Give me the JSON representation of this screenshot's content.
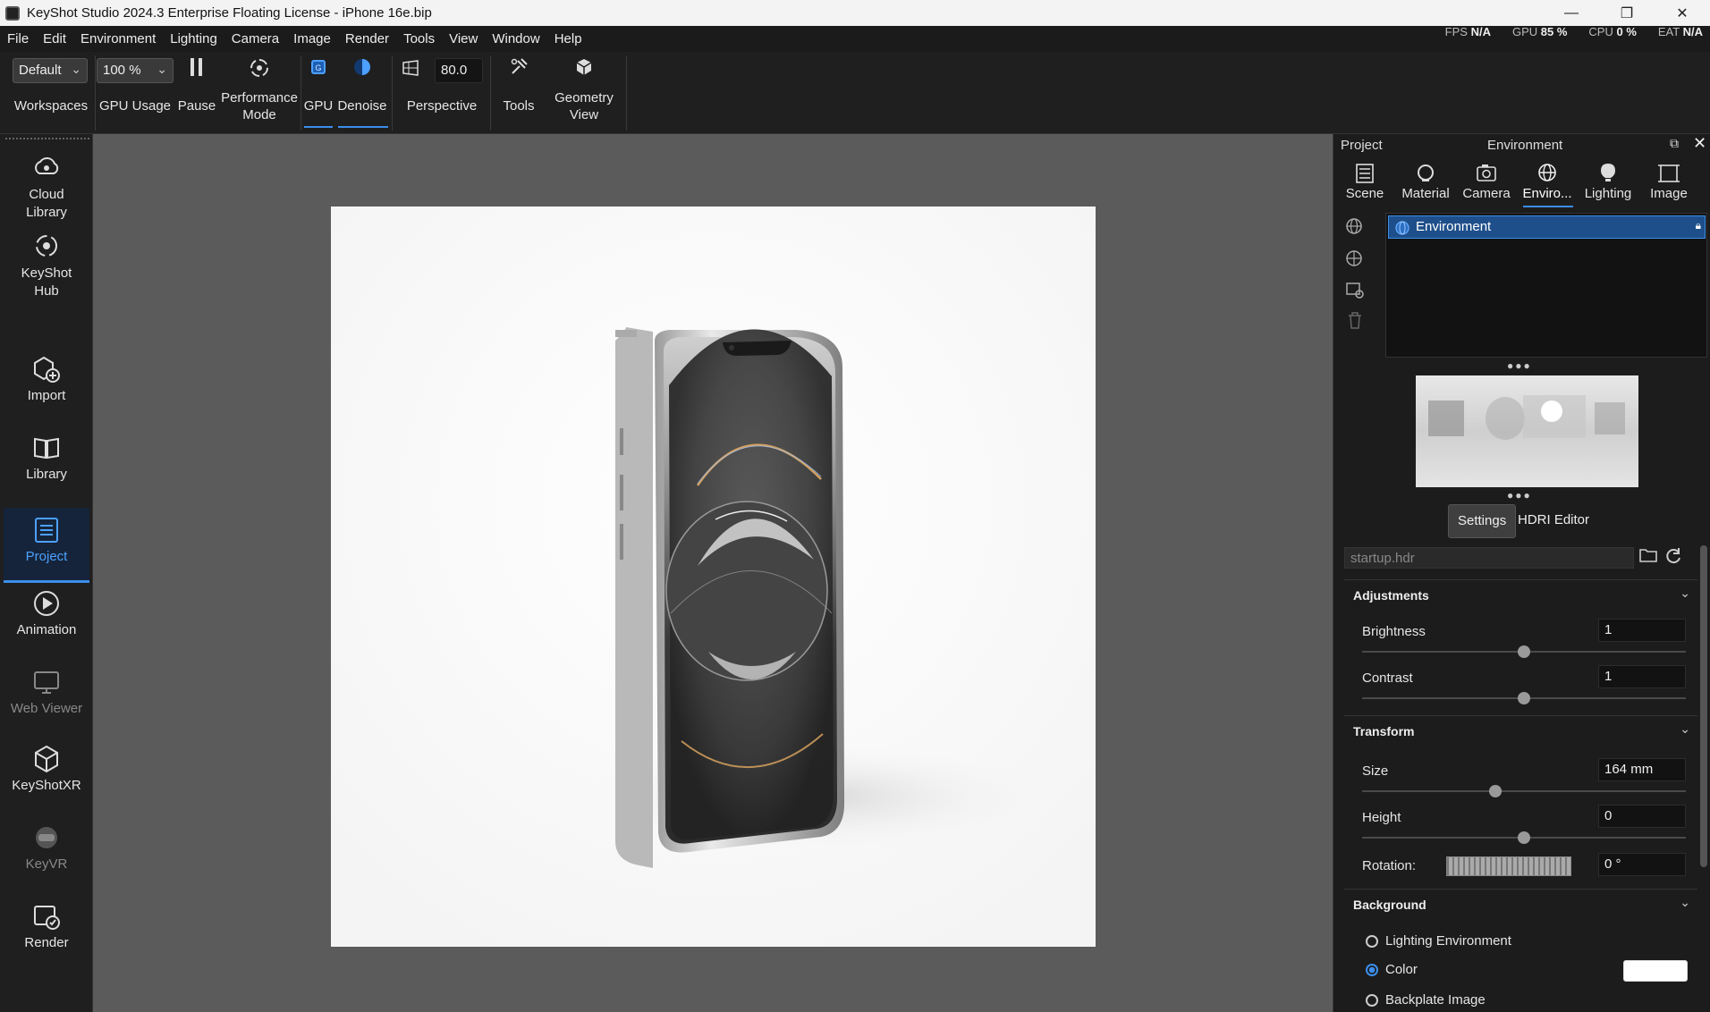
{
  "window": {
    "title": "KeyShot Studio 2024.3 Enterprise Floating License  - iPhone 16e.bip",
    "controls": [
      "—",
      "❐",
      "✕"
    ]
  },
  "menu": [
    "File",
    "Edit",
    "Environment",
    "Lighting",
    "Camera",
    "Image",
    "Render",
    "Tools",
    "View",
    "Window",
    "Help"
  ],
  "status": {
    "fps_label": "FPS",
    "fps": "N/A",
    "gpu_label": "GPU",
    "gpu": "85 %",
    "cpu_label": "CPU",
    "cpu": "0 %",
    "eat_label": "EAT",
    "eat": "N/A"
  },
  "ribbon": {
    "workspace_value": "Default",
    "workspaces_label": "Workspaces",
    "gpu_usage_value": "100 %",
    "gpu_usage_label": "GPU Usage",
    "pause_label": "Pause",
    "performance_mode_label": "Performance\nMode",
    "gpu_label": "GPU",
    "denoise_label": "Denoise",
    "perspective_value": "80.0",
    "perspective_label": "Perspective",
    "tools_label": "Tools",
    "geometry_view_label": "Geometry\nView"
  },
  "left_dock": [
    {
      "label": "Cloud\nLibrary",
      "icon": "cloud-library-icon",
      "state": "normal"
    },
    {
      "label": "KeyShot\nHub",
      "icon": "keyshot-hub-icon",
      "state": "normal"
    },
    {
      "label": "Import",
      "icon": "import-icon",
      "state": "normal"
    },
    {
      "label": "Library",
      "icon": "library-icon",
      "state": "normal"
    },
    {
      "label": "Project",
      "icon": "project-icon",
      "state": "active"
    },
    {
      "label": "Animation",
      "icon": "animation-icon",
      "state": "normal"
    },
    {
      "label": "Web Viewer",
      "icon": "web-viewer-icon",
      "state": "disabled"
    },
    {
      "label": "KeyShotXR",
      "icon": "keyshotxr-icon",
      "state": "normal"
    },
    {
      "label": "KeyVR",
      "icon": "keyvr-icon",
      "state": "disabled"
    },
    {
      "label": "Render",
      "icon": "render-icon",
      "state": "normal"
    }
  ],
  "panel": {
    "project_label": "Project",
    "title": "Environment",
    "tabs": [
      "Scene",
      "Material",
      "Camera",
      "Enviro...",
      "Lighting",
      "Image"
    ],
    "active_tab": "Enviro...",
    "tree_item": "Environment",
    "sub_tabs": [
      "Settings",
      "HDRI Editor"
    ],
    "hdri_file": "startup.hdr",
    "adjustments": {
      "title": "Adjustments",
      "brightness_label": "Brightness",
      "brightness": "1",
      "contrast_label": "Contrast",
      "contrast": "1"
    },
    "transform": {
      "title": "Transform",
      "size_label": "Size",
      "size": "164 mm",
      "height_label": "Height",
      "height": "0",
      "rotation_label": "Rotation:",
      "rotation": "0 °"
    },
    "background": {
      "title": "Background",
      "options": [
        "Lighting Environment",
        "Color",
        "Backplate Image"
      ],
      "selected": "Color",
      "color": "#ffffff"
    }
  },
  "colors": {
    "accent": "#3b8eea",
    "viewport_bg": "#5b5b5b",
    "panel_bg": "#1c1c1c",
    "selection": "#1e4f8a"
  }
}
